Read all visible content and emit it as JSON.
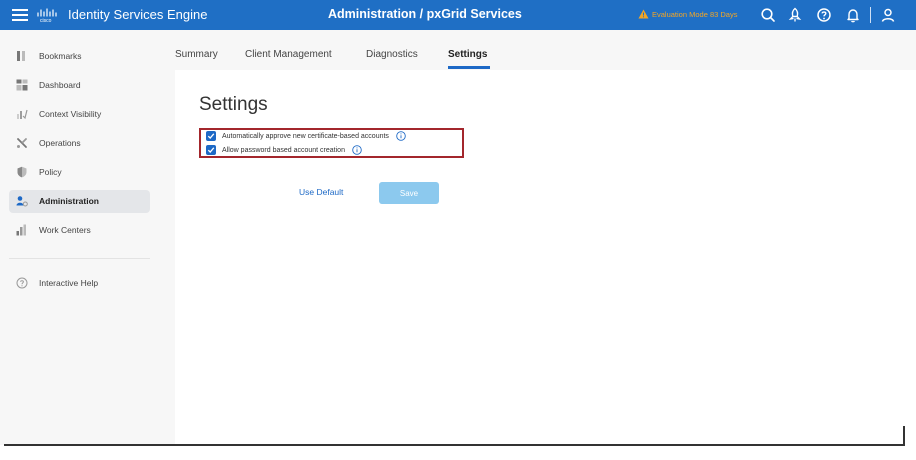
{
  "header": {
    "menu_icon": "hamburger-icon",
    "logo_icon": "cisco-logo-icon",
    "app_name": "Identity Services Engine",
    "page_heading": "Administration / pxGrid Services",
    "evaluation_text": "Evaluation Mode 83 Days",
    "evaluation_color": "#f5a623",
    "icons": [
      "search-icon",
      "rocket-icon",
      "help-icon",
      "bell-icon",
      "user-icon"
    ],
    "bar_color": "#1f6fc5"
  },
  "sidebar": {
    "items": [
      {
        "label": "Bookmarks",
        "icon": "bookmark-icon"
      },
      {
        "label": "Dashboard",
        "icon": "dashboard-icon"
      },
      {
        "label": "Context Visibility",
        "icon": "context-visibility-icon"
      },
      {
        "label": "Operations",
        "icon": "tools-icon"
      },
      {
        "label": "Policy",
        "icon": "shield-icon"
      },
      {
        "label": "Administration",
        "icon": "admin-user-icon"
      },
      {
        "label": "Work Centers",
        "icon": "work-centers-icon"
      }
    ],
    "help": {
      "label": "Interactive Help",
      "icon": "question-circle-icon"
    },
    "active": "Administration"
  },
  "tabs": [
    {
      "label": "Summary"
    },
    {
      "label": "Client Management"
    },
    {
      "label": "Diagnostics"
    },
    {
      "label": "Settings"
    }
  ],
  "active_tab": "Settings",
  "main": {
    "title": "Settings",
    "options": [
      {
        "label": "Automatically approve new certificate-based accounts",
        "checked": true
      },
      {
        "label": "Allow password based account creation",
        "checked": true
      }
    ],
    "use_default_label": "Use Default",
    "save_label": "Save",
    "accent_color": "#1d69c6",
    "highlight_color": "#a3262c"
  }
}
